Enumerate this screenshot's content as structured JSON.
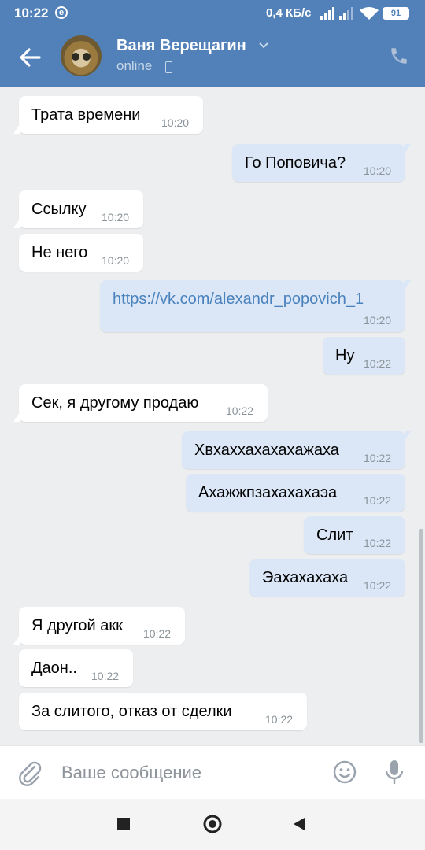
{
  "statusbar": {
    "time": "10:22",
    "speed": "0,4 КБ/с",
    "battery": "91",
    "indicator": "e"
  },
  "header": {
    "contact_name": "Ваня Верещагин",
    "presence": "online"
  },
  "messages": [
    {
      "text": "Трата времени",
      "time": "10:20",
      "dir": "in"
    },
    {
      "text": "Го Поповича?",
      "time": "10:20",
      "dir": "out"
    },
    {
      "text": "Ссылку",
      "time": "10:20",
      "dir": "in"
    },
    {
      "text": "Не него",
      "time": "10:20",
      "dir": "in"
    },
    {
      "text": "https://vk.com/alexandr_popovich_1",
      "time": "10:20",
      "dir": "out"
    },
    {
      "text": "Ну",
      "time": "10:22",
      "dir": "out"
    },
    {
      "text": "Сек, я другому продаю",
      "time": "10:22",
      "dir": "in"
    },
    {
      "text": "Хвхаххахахахажаха",
      "time": "10:22",
      "dir": "out"
    },
    {
      "text": "Ахажжпзахахахаэа",
      "time": "10:22",
      "dir": "out"
    },
    {
      "text": "Слит",
      "time": "10:22",
      "dir": "out"
    },
    {
      "text": "Эахахахаха",
      "time": "10:22",
      "dir": "out"
    },
    {
      "text": "Я другой акк",
      "time": "10:22",
      "dir": "in"
    },
    {
      "text": "Даон..",
      "time": "10:22",
      "dir": "in"
    },
    {
      "text": "За слитого, отказ от сделки",
      "time": "10:22",
      "dir": "in"
    }
  ],
  "composer": {
    "placeholder": "Ваше сообщение",
    "value": ""
  },
  "icons": {
    "back": "arrow-left-icon",
    "call": "phone-icon",
    "attach": "paperclip-icon",
    "emoji": "smile-icon",
    "voice": "microphone-icon"
  },
  "colors": {
    "header": "#5181b8",
    "incoming": "#ffffff",
    "outgoing": "#dbe7f6",
    "background": "#edeef0",
    "link": "#4a82bd"
  }
}
